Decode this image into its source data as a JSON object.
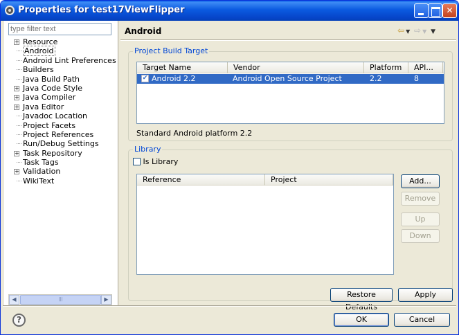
{
  "window": {
    "title": "Properties for test17ViewFlipper"
  },
  "filter": {
    "placeholder": "type filter text"
  },
  "tree": {
    "items": [
      {
        "label": "Resource",
        "expandable": true
      },
      {
        "label": "Android",
        "expandable": false,
        "selected": true
      },
      {
        "label": "Android Lint Preferences",
        "expandable": false
      },
      {
        "label": "Builders",
        "expandable": false
      },
      {
        "label": "Java Build Path",
        "expandable": false
      },
      {
        "label": "Java Code Style",
        "expandable": true
      },
      {
        "label": "Java Compiler",
        "expandable": true
      },
      {
        "label": "Java Editor",
        "expandable": true
      },
      {
        "label": "Javadoc Location",
        "expandable": false
      },
      {
        "label": "Project Facets",
        "expandable": false
      },
      {
        "label": "Project References",
        "expandable": false
      },
      {
        "label": "Run/Debug Settings",
        "expandable": false
      },
      {
        "label": "Task Repository",
        "expandable": true
      },
      {
        "label": "Task Tags",
        "expandable": false
      },
      {
        "label": "Validation",
        "expandable": true
      },
      {
        "label": "WikiText",
        "expandable": false
      }
    ]
  },
  "page": {
    "title": "Android",
    "build_target": {
      "group_label": "Project Build Target",
      "columns": [
        "Target Name",
        "Vendor",
        "Platform",
        "API..."
      ],
      "rows": [
        {
          "checked": true,
          "target": "Android 2.2",
          "vendor": "Android Open Source Project",
          "platform": "2.2",
          "api": "8"
        }
      ],
      "description": "Standard Android platform 2.2"
    },
    "library": {
      "group_label": "Library",
      "is_library_label": "Is Library",
      "is_library_checked": false,
      "columns": [
        "Reference",
        "Project"
      ],
      "add_label": "Add...",
      "remove_label": "Remove",
      "up_label": "Up",
      "down_label": "Down"
    },
    "restore_defaults_label": "Restore Defaults",
    "apply_label": "Apply"
  },
  "dialog": {
    "ok_label": "OK",
    "cancel_label": "Cancel",
    "help_glyph": "?"
  },
  "colors": {
    "selection": "#316ac5",
    "group_title": "#0046d5",
    "title_bar": "#0b5ae0"
  }
}
